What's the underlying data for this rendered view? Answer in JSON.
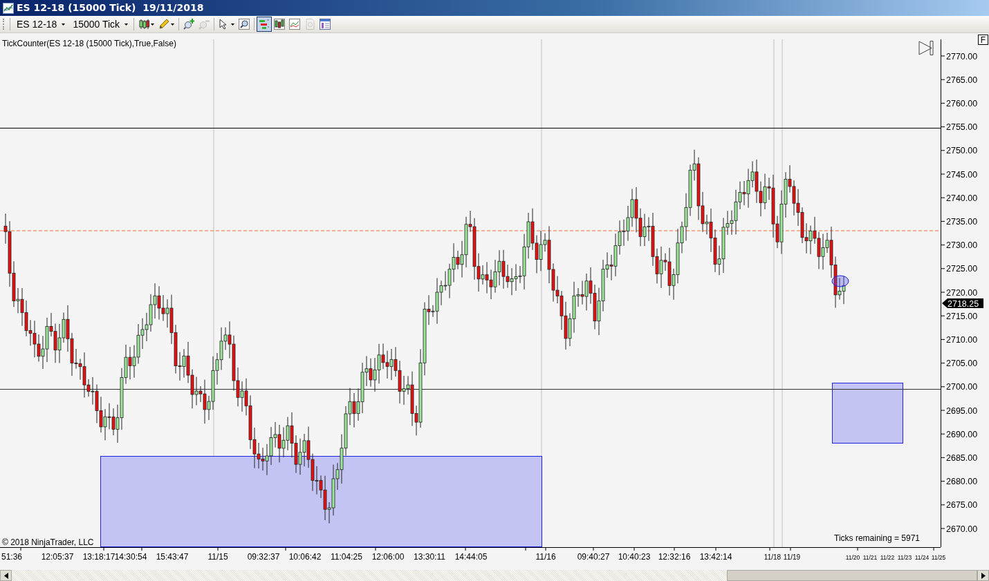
{
  "window": {
    "title": "ES 12-18 (15000 Tick)  19/11/2018"
  },
  "toolbar": [
    {
      "kind": "dropdown",
      "label": "ES 12-18"
    },
    {
      "kind": "dropdown",
      "label": "15000 Tick"
    },
    {
      "kind": "candles",
      "menu": true,
      "selected": false,
      "disabled": false
    },
    {
      "kind": "pencil",
      "menu": true,
      "selected": false,
      "disabled": false
    },
    {
      "kind": "zoom-in",
      "menu": false,
      "selected": false,
      "disabled": false
    },
    {
      "kind": "zoom-out",
      "menu": false,
      "selected": false,
      "disabled": true
    },
    {
      "kind": "cursor",
      "menu": true,
      "selected": false,
      "disabled": false
    },
    {
      "kind": "magnifier",
      "menu": false,
      "selected": false,
      "disabled": false
    },
    {
      "kind": "chart-style",
      "menu": false,
      "selected": true,
      "disabled": false
    },
    {
      "kind": "bars",
      "menu": false,
      "selected": false,
      "disabled": false
    },
    {
      "kind": "line",
      "menu": false,
      "selected": false,
      "disabled": false
    },
    {
      "kind": "document",
      "menu": false,
      "selected": false,
      "disabled": true
    },
    {
      "kind": "properties",
      "menu": false,
      "selected": false,
      "disabled": false
    }
  ],
  "chart": {
    "indicator_label": "TickCounter(ES  12-18 (15000  Tick),True,False)",
    "scale_button": "F",
    "copyright": "© 2018 NinjaTrader, LLC",
    "ticks_remaining": "Ticks remaining = 5971",
    "current_price": "2718.25",
    "price_axis": [
      "2770.00",
      "2765.00",
      "2760.00",
      "2755.00",
      "2750.00",
      "2745.00",
      "2740.00",
      "2735.00",
      "2730.00",
      "2725.00",
      "2720.00",
      "2715.00",
      "2710.00",
      "2705.00",
      "2700.00",
      "2695.00",
      "2690.00",
      "2685.00",
      "2680.00",
      "2675.00",
      "2670.00"
    ],
    "time_axis": [
      "51:36",
      "12:05:37",
      "13:18:17",
      "14:30:54",
      "15:43:47",
      "11/15",
      "09:32:37",
      "10:06:42",
      "11:04:25",
      "12:06:00",
      "13:30:11",
      "14:44:05",
      "11/16",
      "09:40:27",
      "10:40:23",
      "12:32:16",
      "13:42:14",
      "11/18",
      "11/19",
      "11/20",
      "11/21",
      "11/22",
      "11/23",
      "11/24",
      "11/25"
    ]
  }
}
